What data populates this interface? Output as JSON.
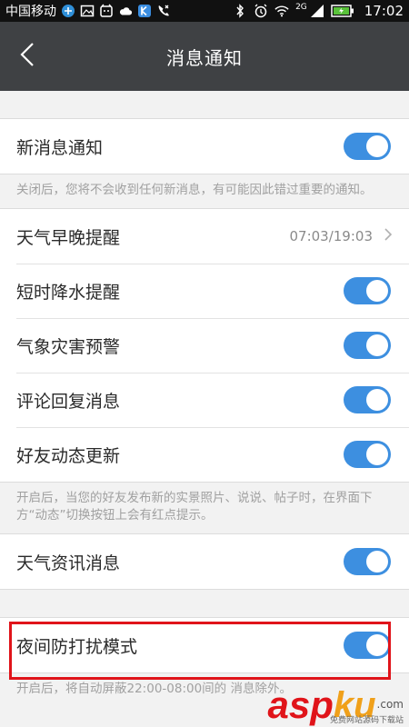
{
  "status_bar": {
    "carrier": "中国移动",
    "network": "2G",
    "time": "17:02"
  },
  "header": {
    "title": "消息通知"
  },
  "settings": {
    "new_message": {
      "label": "新消息通知",
      "enabled": true
    },
    "new_message_note": "关闭后，您将不会收到任何新消息，有可能因此错过重要的通知。",
    "weather_reminder": {
      "label": "天气早晚提醒",
      "value": "07:03/19:03"
    },
    "rain_alert": {
      "label": "短时降水提醒",
      "enabled": true
    },
    "disaster_warning": {
      "label": "气象灾害预警",
      "enabled": true
    },
    "comment_reply": {
      "label": "评论回复消息",
      "enabled": true
    },
    "friend_updates": {
      "label": "好友动态更新",
      "enabled": true
    },
    "friend_updates_note": "开启后，当您的好友发布新的实景照片、说说、帖子时，在界面下方“动态”切换按钮上会有红点提示。",
    "weather_news": {
      "label": "天气资讯消息",
      "enabled": true
    },
    "night_mode": {
      "label": "夜间防打扰模式",
      "enabled": true
    },
    "night_mode_note": "开启后，将自动屏蔽22:00-08:00间的        消息除外。"
  },
  "watermark": {
    "brand": "asp",
    "brand2": "ku",
    "domain": ".com",
    "tagline": "免费网站源码下载站"
  },
  "colors": {
    "accent": "#3d8fe0",
    "highlight": "#e0141a",
    "header_bg": "#3f4144"
  }
}
